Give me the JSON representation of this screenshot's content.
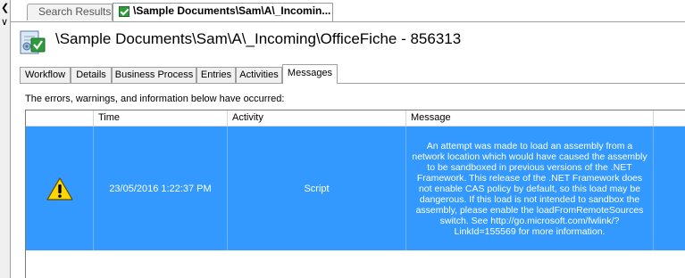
{
  "window": {
    "tabs": [
      {
        "label": "Search Results",
        "active": false
      },
      {
        "label": "\\Sample Documents\\Sam\\A\\_Incomin...",
        "active": true,
        "icon": "green-check-icon"
      }
    ]
  },
  "header": {
    "title": "\\Sample Documents\\Sam\\A\\_Incoming\\OfficeFiche - 856313",
    "icon": "document-workflow-icon"
  },
  "inner_tabs": [
    {
      "label": "Workflow",
      "active": false
    },
    {
      "label": "Details",
      "active": false
    },
    {
      "label": "Business Process",
      "active": false
    },
    {
      "label": "Entries",
      "active": false
    },
    {
      "label": "Activities",
      "active": false
    },
    {
      "label": "Messages",
      "active": true
    }
  ],
  "messages_panel": {
    "info_text": "The errors, warnings, and information below have occurred:",
    "columns": [
      "",
      "Time",
      "Activity",
      "Message"
    ],
    "rows": [
      {
        "icon": "warning-icon",
        "time": "23/05/2016 1:22:37 PM",
        "activity": "Script",
        "message": "An attempt was made to load an assembly from a network location which would have caused the assembly to be sandboxed in previous versions of the .NET Framework. This release of the .NET Framework does not enable CAS policy by default, so this load may be dangerous. If this load is not intended to sandbox the assembly, please enable the loadFromRemoteSources switch. See http://go.microsoft.com/fwlink/?LinkId=155569 for more information.",
        "selected": true
      }
    ]
  },
  "colors": {
    "selection": "#3399ff",
    "warning": "#ffd700",
    "check": "#2f9b3b"
  }
}
